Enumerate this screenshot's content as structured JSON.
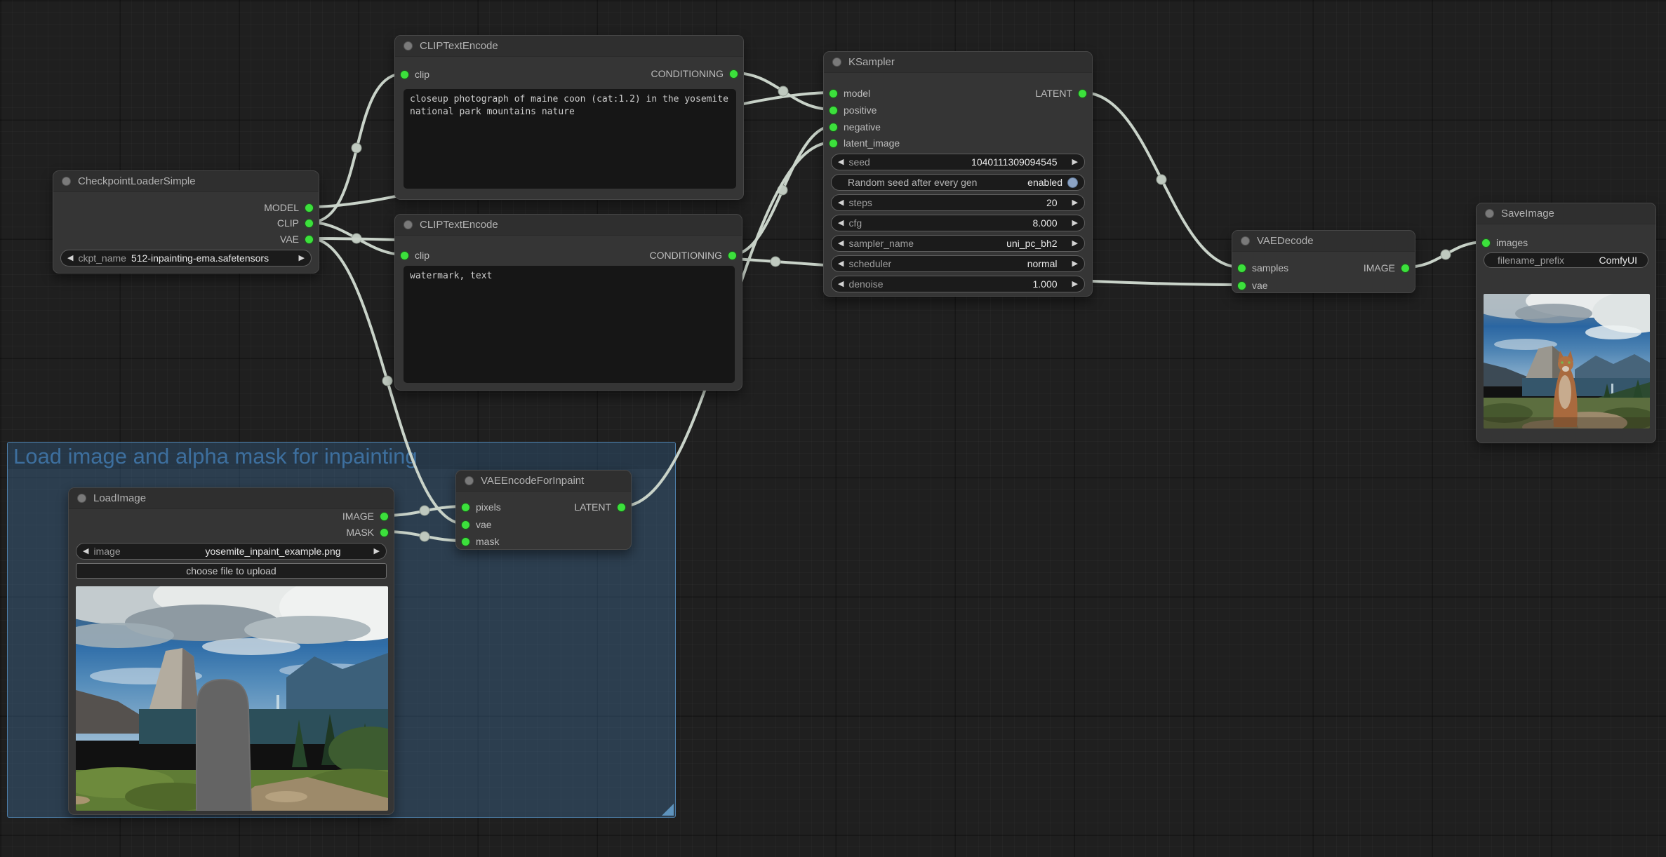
{
  "group": {
    "title": "Load image and alpha mask for inpainting"
  },
  "nodes": {
    "checkpoint_loader": {
      "title": "CheckpointLoaderSimple",
      "outputs": [
        "MODEL",
        "CLIP",
        "VAE"
      ],
      "widgets": {
        "ckpt_name": {
          "label": "ckpt_name",
          "value": "512-inpainting-ema.safetensors"
        }
      }
    },
    "clip_positive": {
      "title": "CLIPTextEncode",
      "inputs": [
        "clip"
      ],
      "outputs": [
        "CONDITIONING"
      ],
      "text": "closeup photograph of maine coon (cat:1.2) in the yosemite national park mountains nature"
    },
    "clip_negative": {
      "title": "CLIPTextEncode",
      "inputs": [
        "clip"
      ],
      "outputs": [
        "CONDITIONING"
      ],
      "text": "watermark, text"
    },
    "ksampler": {
      "title": "KSampler",
      "inputs": [
        "model",
        "positive",
        "negative",
        "latent_image"
      ],
      "outputs": [
        "LATENT"
      ],
      "widgets": {
        "seed": {
          "label": "seed",
          "value": "1040111309094545"
        },
        "random_seed": {
          "label": "Random seed after every gen",
          "value": "enabled"
        },
        "steps": {
          "label": "steps",
          "value": "20"
        },
        "cfg": {
          "label": "cfg",
          "value": "8.000"
        },
        "sampler_name": {
          "label": "sampler_name",
          "value": "uni_pc_bh2"
        },
        "scheduler": {
          "label": "scheduler",
          "value": "normal"
        },
        "denoise": {
          "label": "denoise",
          "value": "1.000"
        }
      }
    },
    "vae_decode": {
      "title": "VAEDecode",
      "inputs": [
        "samples",
        "vae"
      ],
      "outputs": [
        "IMAGE"
      ]
    },
    "save_image": {
      "title": "SaveImage",
      "inputs": [
        "images"
      ],
      "widgets": {
        "filename_prefix": {
          "label": "filename_prefix",
          "value": "ComfyUI"
        }
      }
    },
    "load_image": {
      "title": "LoadImage",
      "outputs": [
        "IMAGE",
        "MASK"
      ],
      "widgets": {
        "image": {
          "label": "image",
          "value": "yosemite_inpaint_example.png"
        }
      },
      "button": "choose file to upload"
    },
    "vae_encode_inpaint": {
      "title": "VAEEncodeForInpaint",
      "inputs": [
        "pixels",
        "vae",
        "mask"
      ],
      "outputs": [
        "LATENT"
      ]
    }
  },
  "icons": {
    "decrement": "◀",
    "increment": "▶"
  },
  "colors": {
    "canvas_bg": "#1f1f1f",
    "node_body": "#353535",
    "node_title": "#2f2f2f",
    "link": "#c9d3c9",
    "socket_green": "#3ce03c",
    "group_fill": "rgba(66,113,158,0.38)",
    "group_border": "#4e81ad",
    "group_title_text": "#3d6f9e",
    "toggle_ball": "#8ca3c4"
  }
}
